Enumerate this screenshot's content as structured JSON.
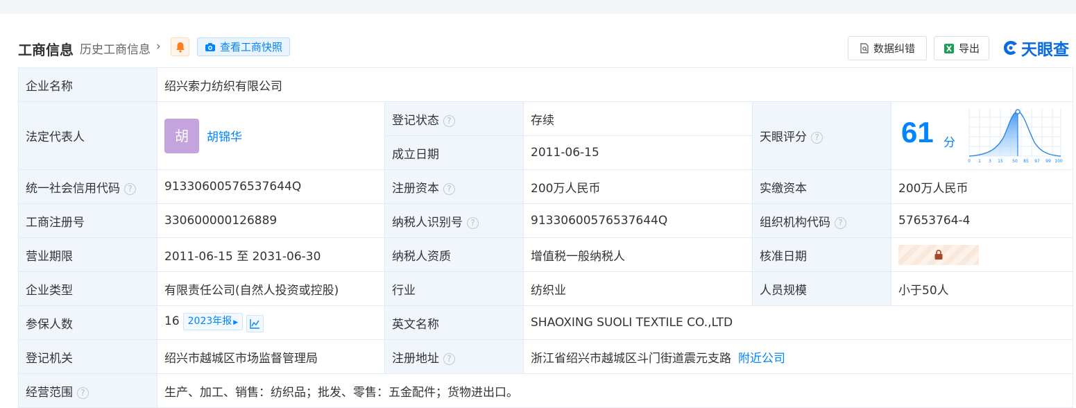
{
  "header": {
    "title": "工商信息",
    "history_link": "历史工商信息",
    "history_chevron": "›",
    "bell_icon": "bell-icon",
    "snapshot_button": "查看工商快照",
    "correct_button": "数据纠错",
    "export_button": "导出",
    "logo_text": "天眼查"
  },
  "colors": {
    "accent": "#0084ff",
    "status_green": "#1f9e58",
    "label_bg": "#f1f6fd",
    "avatar_bg": "#c5a3dc",
    "bell_orange": "#ff7d1a"
  },
  "company": {
    "name_label": "企业名称",
    "name_value": "绍兴索力纺织有限公司",
    "legal_rep_label": "法定代表人",
    "legal_rep_avatar": "胡",
    "legal_rep_name": "胡锦华",
    "reg_status_label": "登记状态",
    "reg_status_value": "存续",
    "founded_label": "成立日期",
    "founded_value": "2011-06-15",
    "score_label": "天眼评分",
    "score_value": "61",
    "score_unit": "分",
    "score_axis": [
      "0",
      "1",
      "3",
      "15",
      "50",
      "85",
      "97",
      "99",
      "100"
    ],
    "credit_code_label": "统一社会信用代码",
    "credit_code_value": "91330600576537644Q",
    "reg_capital_label": "注册资本",
    "reg_capital_value": "200万人民币",
    "paid_capital_label": "实缴资本",
    "paid_capital_value": "200万人民币",
    "biz_reg_no_label": "工商注册号",
    "biz_reg_no_value": "330600000126889",
    "taxpayer_id_label": "纳税人识别号",
    "taxpayer_id_value": "91330600576537644Q",
    "org_code_label": "组织机构代码",
    "org_code_value": "57653764-4",
    "term_label": "营业期限",
    "term_value": "2011-06-15 至 2031-06-30",
    "taxpayer_qual_label": "纳税人资质",
    "taxpayer_qual_value": "增值税一般纳税人",
    "approval_date_label": "核准日期",
    "approval_date_icon": "lock-icon",
    "type_label": "企业类型",
    "type_value": "有限责任公司(自然人投资或控股)",
    "industry_label": "行业",
    "industry_value": "纺织业",
    "staff_size_label": "人员规模",
    "staff_size_value": "小于50人",
    "insured_label": "参保人数",
    "insured_value": "16",
    "insured_year_badge": "2023年报",
    "english_name_label": "英文名称",
    "english_name_value": "SHAOXING SUOLI TEXTILE CO.,LTD",
    "authority_label": "登记机关",
    "authority_value": "绍兴市越城区市场监督管理局",
    "address_label": "注册地址",
    "address_value": "浙江省绍兴市越城区斗门街道震元支路",
    "nearby_link": "附近公司",
    "scope_label": "经营范围",
    "scope_value": "生产、加工、销售：纺织品；批发、零售：五金配件；货物进出口。"
  }
}
